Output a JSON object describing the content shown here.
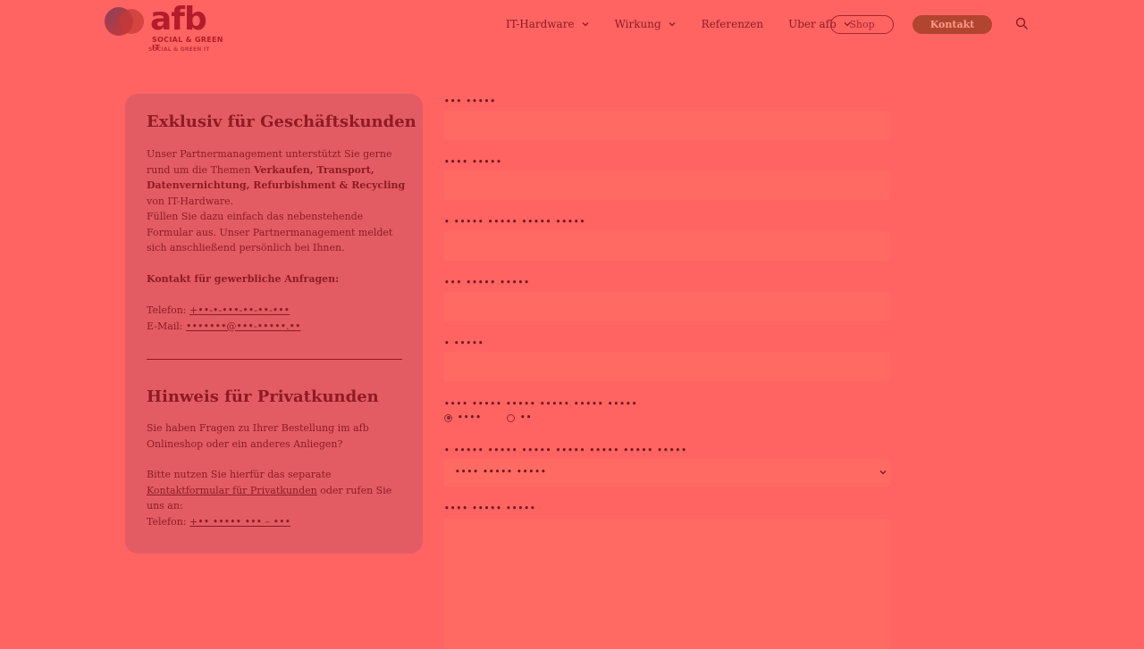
{
  "header": {
    "logo_text": "afb",
    "logo_tagline": "SOCIAL & GREEN IT",
    "logo_tagline_small": "SOCIAL & GREEN IT",
    "nav": [
      {
        "label": "IT-Hardware",
        "has_dropdown": true
      },
      {
        "label": "Wirkung",
        "has_dropdown": true
      },
      {
        "label": "Referenzen",
        "has_dropdown": false
      },
      {
        "label": "Uber afb",
        "has_dropdown": true
      }
    ],
    "shop_label": "Shop",
    "kontakt_label": "Kontakt",
    "search_icon": "search-icon"
  },
  "panel": {
    "business_title": "Exklusiv für Geschäftskunden",
    "business_intro_1": "Unser Partnermanagement unterstützt Sie gerne rund um die Themen",
    "business_intro_bold": "Verkaufen, Transport, Datenvernichtung, Refurbishment & Recycling",
    "business_intro_2": "von IT-Hardware.",
    "business_text_2": "Füllen Sie dazu einfach das nebenstehende Formular aus. Unser Partnermanagement meldet sich anschließend persönlich bei Ihnen.",
    "contact_heading": "Kontakt für gewerbliche Anfragen:",
    "phone_label": "Telefon:",
    "phone_value": "+••-•-•••-••-••-•••",
    "email_label": "E-Mail:",
    "email_value": "•••••••@•••-•••••.••",
    "private_title": "Hinweis für Privatkunden",
    "private_text_1": "Sie haben Fragen zu Ihrer Bestellung im afb Onlineshop oder ein anderes Anliegen?",
    "private_text_2a": "Bitte nutzen Sie hierfür das separate",
    "private_link": "Kontaktformular für Privatkunden",
    "private_text_2b": "oder rufen Sie uns an:",
    "private_phone_label": "Telefon:",
    "private_phone_value": "+•• ••••• ••• – •••"
  },
  "form": {
    "fields": [
      {
        "label": "••• •••••"
      },
      {
        "label": "•••• •••••"
      },
      {
        "label": "• ••••• ••••• ••••• •••••"
      },
      {
        "label": "••• ••••• •••••"
      },
      {
        "label": "• •••••"
      }
    ],
    "radio_label": "•••• ••••• ••••• ••••• ••••• •••••",
    "radio_options": [
      {
        "label": "••••",
        "selected": true
      },
      {
        "label": "••",
        "selected": false
      }
    ],
    "select_label": "• ••••• ••••• ••••• ••••• ••••• ••••• •••••",
    "select_value": "•••• ••••• •••••",
    "textarea_label": "•••• ••••• •••••"
  },
  "colors": {
    "background": "#ff6462",
    "panel": "#e35c64",
    "text": "#8e1b22",
    "kontakt_button": "#b1452f"
  }
}
